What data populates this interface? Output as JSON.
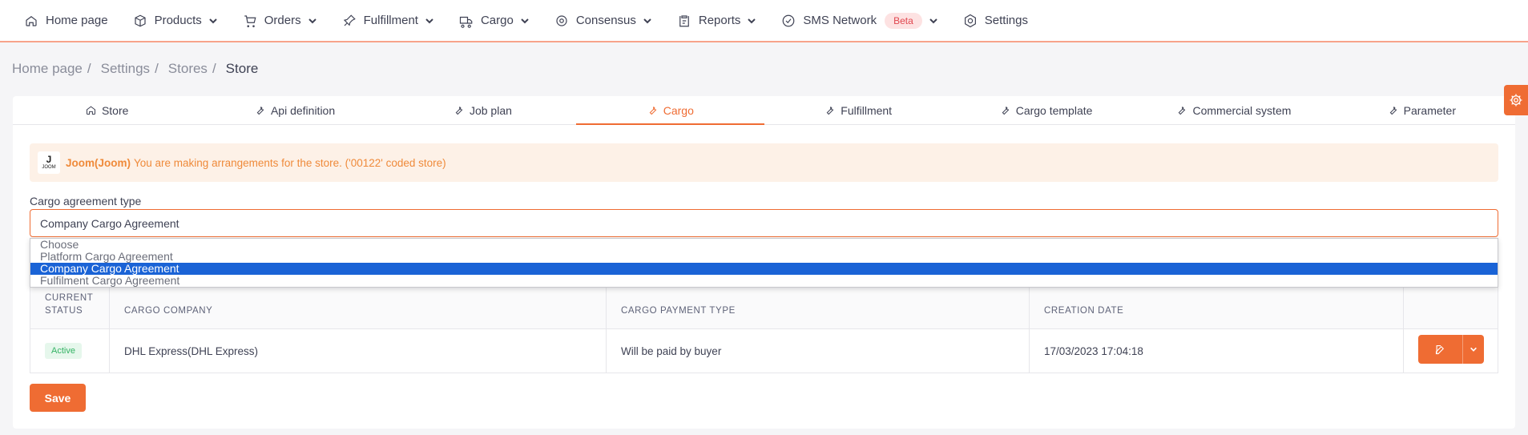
{
  "nav": {
    "items": [
      {
        "label": "Home page",
        "icon": "home-icon",
        "dropdown": false
      },
      {
        "label": "Products",
        "icon": "box-icon",
        "dropdown": true
      },
      {
        "label": "Orders",
        "icon": "cart-icon",
        "dropdown": true
      },
      {
        "label": "Fulfillment",
        "icon": "pin-icon",
        "dropdown": true
      },
      {
        "label": "Cargo",
        "icon": "truck-icon",
        "dropdown": true
      },
      {
        "label": "Consensus",
        "icon": "eye-icon",
        "dropdown": true
      },
      {
        "label": "Reports",
        "icon": "clipboard-icon",
        "dropdown": true
      },
      {
        "label": "SMS Network",
        "icon": "check-circle-icon",
        "dropdown": true,
        "badge": "Beta"
      },
      {
        "label": "Settings",
        "icon": "gear-icon",
        "dropdown": false
      }
    ]
  },
  "breadcrumb": {
    "items": [
      "Home page",
      "Settings",
      "Stores"
    ],
    "separator": "/",
    "current": "Store"
  },
  "tabs": [
    {
      "label": "Store",
      "icon": "home-icon"
    },
    {
      "label": "Api definition",
      "icon": "wrench-icon"
    },
    {
      "label": "Job plan",
      "icon": "wrench-icon"
    },
    {
      "label": "Cargo",
      "icon": "wrench-icon",
      "active": true
    },
    {
      "label": "Fulfillment",
      "icon": "wrench-icon"
    },
    {
      "label": "Cargo template",
      "icon": "wrench-icon"
    },
    {
      "label": "Commercial system",
      "icon": "wrench-icon"
    },
    {
      "label": "Parameter",
      "icon": "wrench-icon"
    }
  ],
  "notice": {
    "logo_letter": "J",
    "logo_text": "JOOM",
    "store_name": "Joom(Joom)",
    "message": "You are making arrangements for the store. ('00122' coded store)"
  },
  "cargo_agreement": {
    "label": "Cargo agreement type",
    "value": "Company Cargo Agreement",
    "options": [
      "Choose",
      "Platform Cargo Agreement",
      "Company Cargo Agreement",
      "Fulfilment Cargo Agreement"
    ],
    "selected_index": 2
  },
  "table": {
    "headers": {
      "status_line1": "CURRENT",
      "status_line2": "STATUS",
      "company": "CARGO COMPANY",
      "payment": "CARGO PAYMENT TYPE",
      "date": "CREATION DATE"
    },
    "rows": [
      {
        "status": "Active",
        "company": "DHL Express(DHL Express)",
        "payment": "Will be paid by buyer",
        "date": "17/03/2023 17:04:18"
      }
    ]
  },
  "save_label": "Save",
  "colors": {
    "accent": "#ef6c33",
    "selected_option": "#1a63d6",
    "active_badge": "#34b364",
    "notice_bg": "#fdf1e7"
  }
}
